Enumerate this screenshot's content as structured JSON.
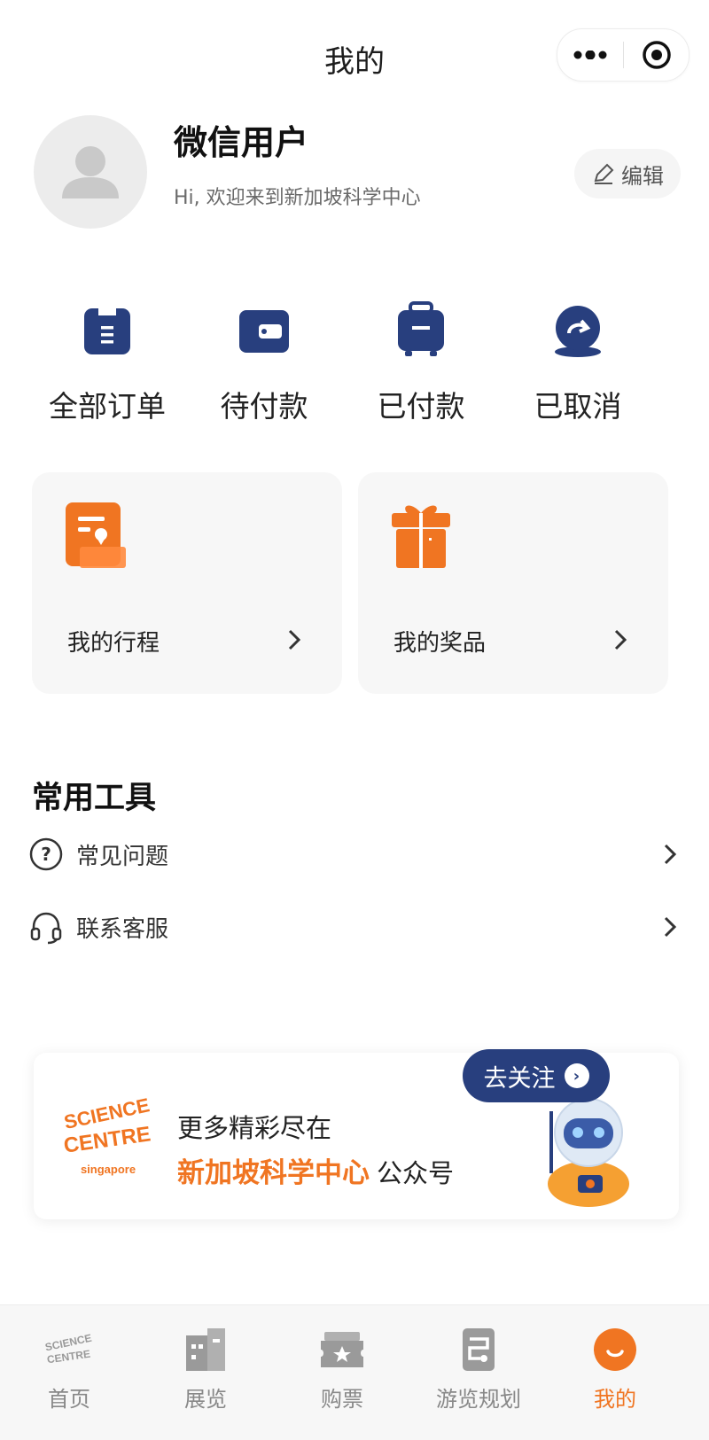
{
  "header": {
    "title": "我的",
    "menu_icon": "more-dots-icon",
    "close_icon": "target-circle-icon"
  },
  "profile": {
    "name": "微信用户",
    "greeting": "Hi, 欢迎来到新加坡科学中心",
    "edit_label": "编辑",
    "avatar_icon": "default-avatar-icon"
  },
  "orders": [
    {
      "label": "全部订单",
      "icon": "clipboard-icon"
    },
    {
      "label": "待付款",
      "icon": "wallet-icon"
    },
    {
      "label": "已付款",
      "icon": "suitcase-icon"
    },
    {
      "label": "已取消",
      "icon": "refresh-return-icon"
    }
  ],
  "cards": [
    {
      "label": "我的行程",
      "icon": "itinerary-location-icon"
    },
    {
      "label": "我的奖品",
      "icon": "gift-icon"
    }
  ],
  "tools": {
    "title": "常用工具",
    "items": [
      {
        "label": "常见问题",
        "icon": "question-circle-icon"
      },
      {
        "label": "联系客服",
        "icon": "headset-icon"
      }
    ]
  },
  "banner": {
    "line1": "更多精彩尽在",
    "highlight": "新加坡科学中心",
    "suffix": "公众号",
    "follow_label": "去关注",
    "logo_text_1": "SCIENCE",
    "logo_text_2": "CENTRE",
    "logo_text_3": "singapore"
  },
  "tabbar": {
    "items": [
      {
        "label": "首页",
        "icon": "science-centre-logo-icon",
        "active": false
      },
      {
        "label": "展览",
        "icon": "buildings-icon",
        "active": false
      },
      {
        "label": "购票",
        "icon": "ticket-star-icon",
        "active": false
      },
      {
        "label": "游览规划",
        "icon": "route-plan-icon",
        "active": false
      },
      {
        "label": "我的",
        "icon": "smile-face-icon",
        "active": true
      }
    ]
  },
  "colors": {
    "accent_orange": "#f07522",
    "navy": "#283f7e",
    "inactive_gray": "#888888"
  }
}
